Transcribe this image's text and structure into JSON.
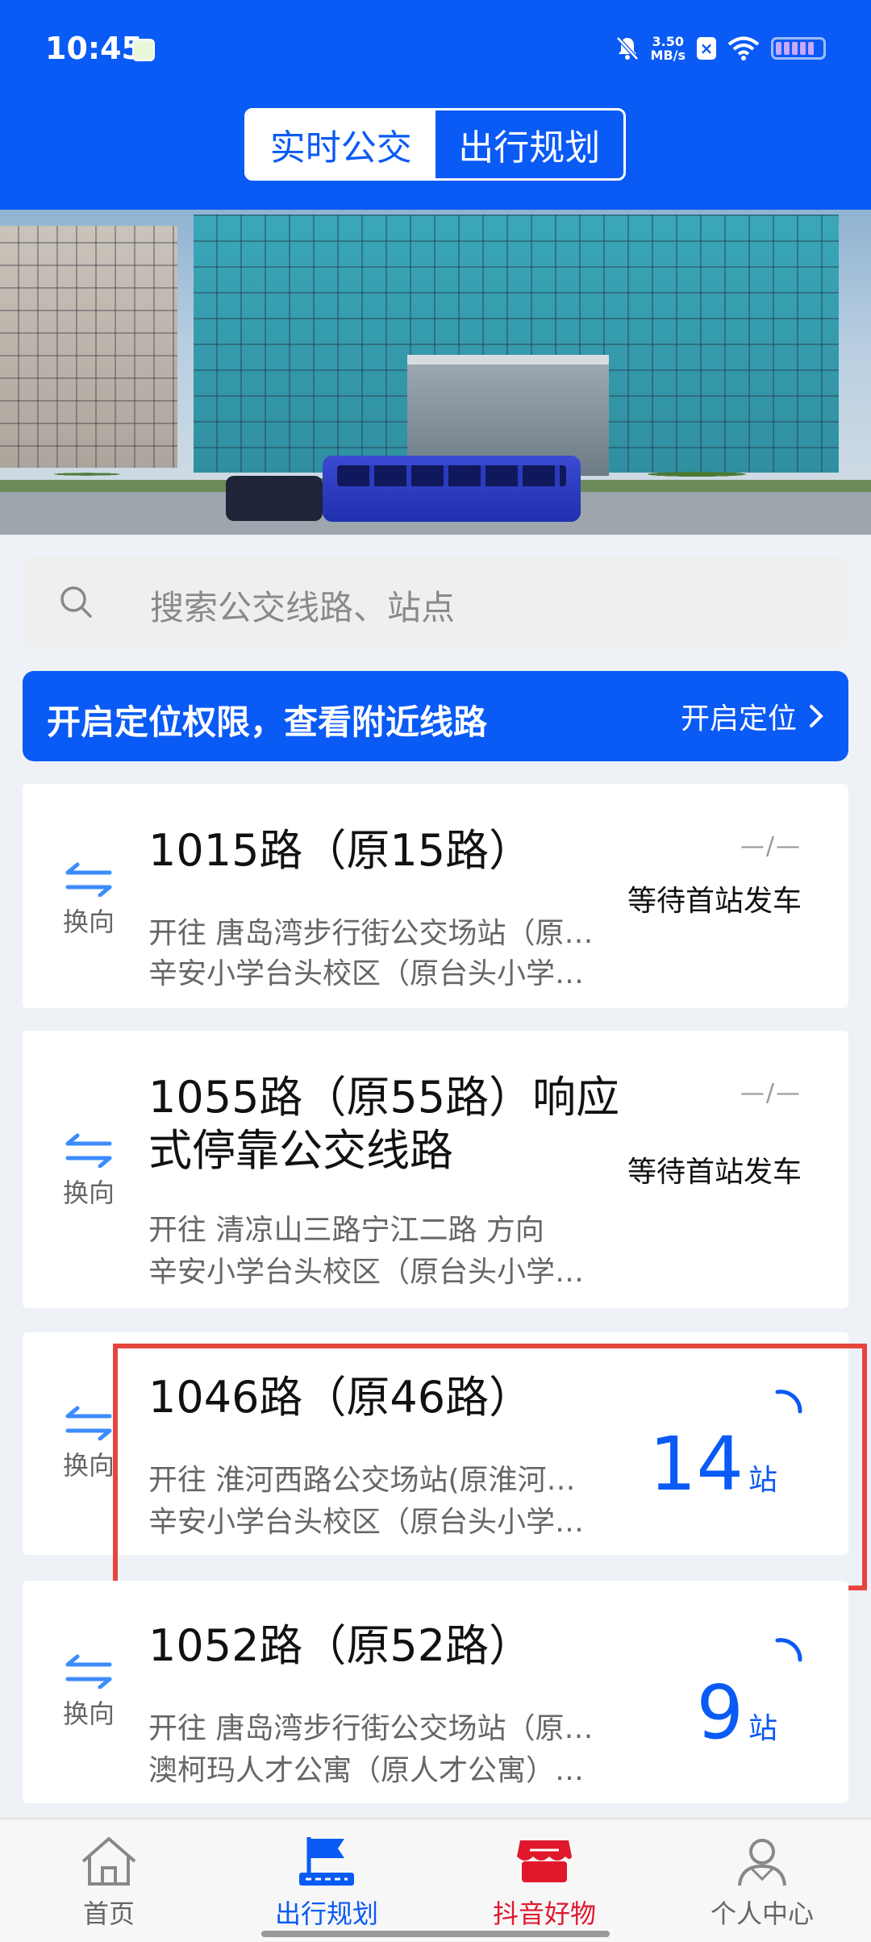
{
  "status_bar": {
    "time": "10:45",
    "net_speed_value": "3.50",
    "net_speed_unit": "MB/s",
    "icons": [
      "app-notification-icon",
      "mute-icon",
      "x-icon",
      "wifi-icon",
      "battery-icon"
    ]
  },
  "top_tabs": [
    {
      "label": "实时公交",
      "active": true
    },
    {
      "label": "出行规划",
      "active": false
    }
  ],
  "search": {
    "placeholder": "搜索公交线路、站点"
  },
  "location_bar": {
    "text": "开启定位权限，查看附近线路",
    "button": "开启定位"
  },
  "routes": [
    {
      "name": "1015路（原15路）",
      "direction_label": "换向",
      "line1": "开往 唐岛湾步行街公交场站（原…",
      "line2": "辛安小学台头校区（原台头小学…",
      "dash": "—/—",
      "status": "等待首站发车"
    },
    {
      "name_line1": "1055路（原55路）响应",
      "name_line2": "式停靠公交线路",
      "direction_label": "换向",
      "line1": "开往 清凉山三路宁江二路 方向",
      "line2": "辛安小学台头校区（原台头小学…",
      "dash": "—/—",
      "status": "等待首站发车"
    },
    {
      "name": "1046路（原46路）",
      "direction_label": "换向",
      "line1": "开往 淮河西路公交场站(原淮河…",
      "line2": "辛安小学台头校区（原台头小学…",
      "stops": "14",
      "stops_unit": "站"
    },
    {
      "name": "1052路（原52路）",
      "direction_label": "换向",
      "line1": "开往 唐岛湾步行街公交场站（原…",
      "line2": "澳柯玛人才公寓（原人才公寓）…",
      "stops": "9",
      "stops_unit": "站"
    }
  ],
  "bottom_nav": [
    {
      "label": "首页",
      "icon": "home-icon"
    },
    {
      "label": "出行规划",
      "icon": "flag-route-icon",
      "active": true
    },
    {
      "label": "抖音好物",
      "icon": "shop-icon"
    },
    {
      "label": "个人中心",
      "icon": "person-icon"
    }
  ],
  "colors": {
    "primary": "#0a5af5",
    "highlight": "#e6453f",
    "douyin": "#e0182c"
  }
}
